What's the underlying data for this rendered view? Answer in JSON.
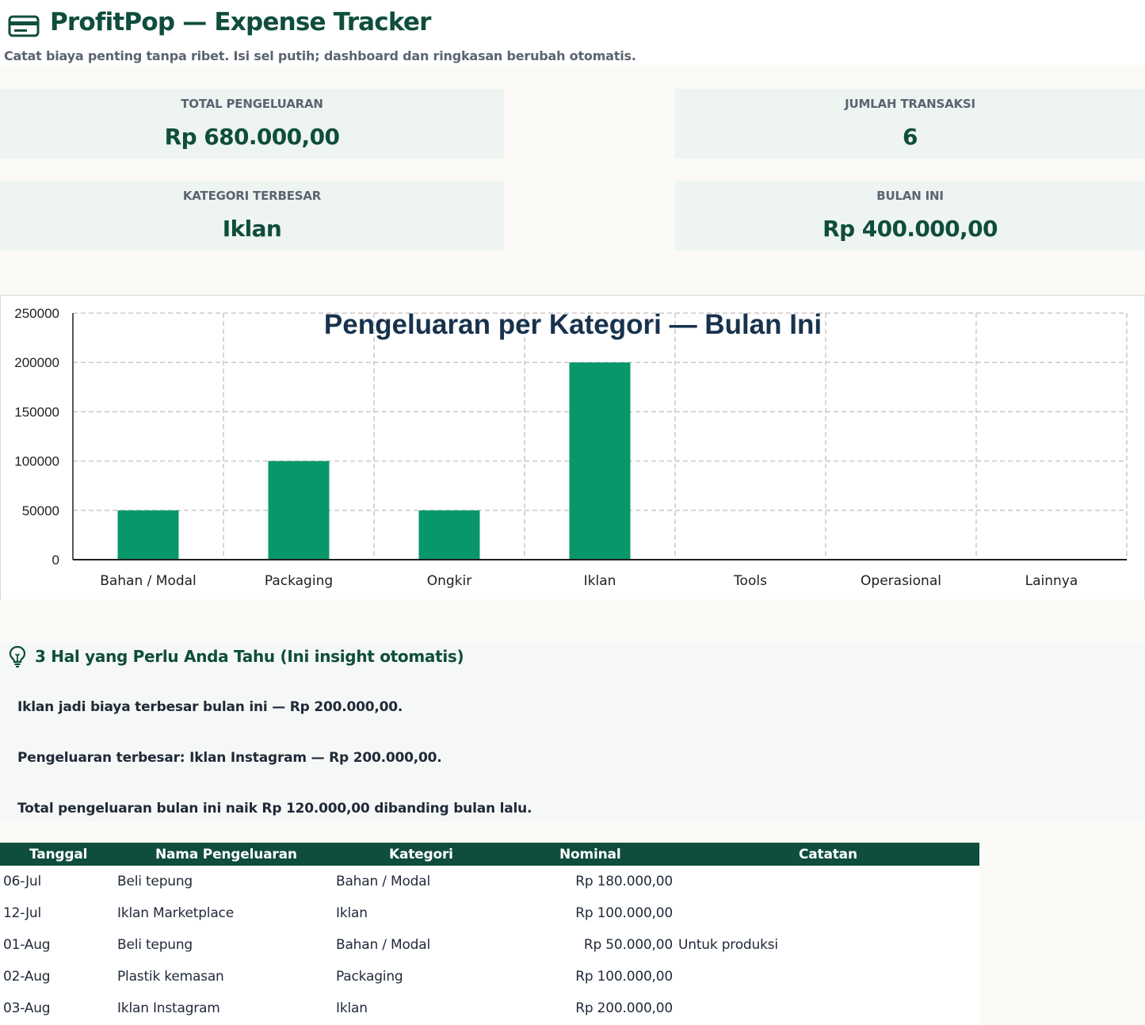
{
  "header": {
    "title": "ProfitPop — Expense Tracker",
    "subtitle": "Catat biaya penting tanpa ribet. Isi sel putih; dashboard dan ringkasan berubah otomatis.",
    "logo_icon": "credit-card-icon"
  },
  "colors": {
    "brand": "#0f4d3c",
    "bar": "#07976a",
    "chart_title": "#17324d",
    "panel": "#eef4f1"
  },
  "kpis": [
    {
      "label": "TOTAL PENGELUARAN",
      "value": "Rp 680.000,00"
    },
    {
      "label": "JUMLAH TRANSAKSI",
      "value": "6"
    },
    {
      "label": "KATEGORI TERBESAR",
      "value": "Iklan"
    },
    {
      "label": "BULAN INI",
      "value": "Rp 400.000,00"
    }
  ],
  "chart_data": {
    "type": "bar",
    "title": "Pengeluaran per Kategori — Bulan Ini",
    "categories": [
      "Bahan / Modal",
      "Packaging",
      "Ongkir",
      "Iklan",
      "Tools",
      "Operasional",
      "Lainnya"
    ],
    "values": [
      50000,
      100000,
      50000,
      200000,
      0,
      0,
      0
    ],
    "ylim": [
      0,
      250000
    ],
    "yticks": [
      0,
      50000,
      100000,
      150000,
      200000,
      250000
    ],
    "xlabel": "",
    "ylabel": "",
    "grid": true,
    "legend": "none"
  },
  "insights": {
    "icon": "lightbulb-icon",
    "title": "3 Hal yang Perlu Anda Tahu (Ini insight otomatis)",
    "items": [
      "Iklan jadi biaya terbesar bulan ini — Rp 200.000,00.",
      "Pengeluaran terbesar: Iklan Instagram — Rp 200.000,00.",
      "Total pengeluaran bulan ini naik Rp 120.000,00 dibanding bulan lalu."
    ]
  },
  "table": {
    "headers": [
      "Tanggal",
      "Nama Pengeluaran",
      "Kategori",
      "Nominal",
      "Catatan"
    ],
    "rows": [
      {
        "date": "06-Jul",
        "name": "Beli tepung",
        "category": "Bahan / Modal",
        "amount": "Rp 180.000,00",
        "note": ""
      },
      {
        "date": "12-Jul",
        "name": "Iklan Marketplace",
        "category": "Iklan",
        "amount": "Rp 100.000,00",
        "note": ""
      },
      {
        "date": "01-Aug",
        "name": "Beli tepung",
        "category": "Bahan / Modal",
        "amount": "Rp 50.000,00",
        "note": "Untuk produksi"
      },
      {
        "date": "02-Aug",
        "name": "Plastik kemasan",
        "category": "Packaging",
        "amount": "Rp 100.000,00",
        "note": ""
      },
      {
        "date": "03-Aug",
        "name": "Iklan Instagram",
        "category": "Iklan",
        "amount": "Rp 200.000,00",
        "note": ""
      }
    ]
  }
}
